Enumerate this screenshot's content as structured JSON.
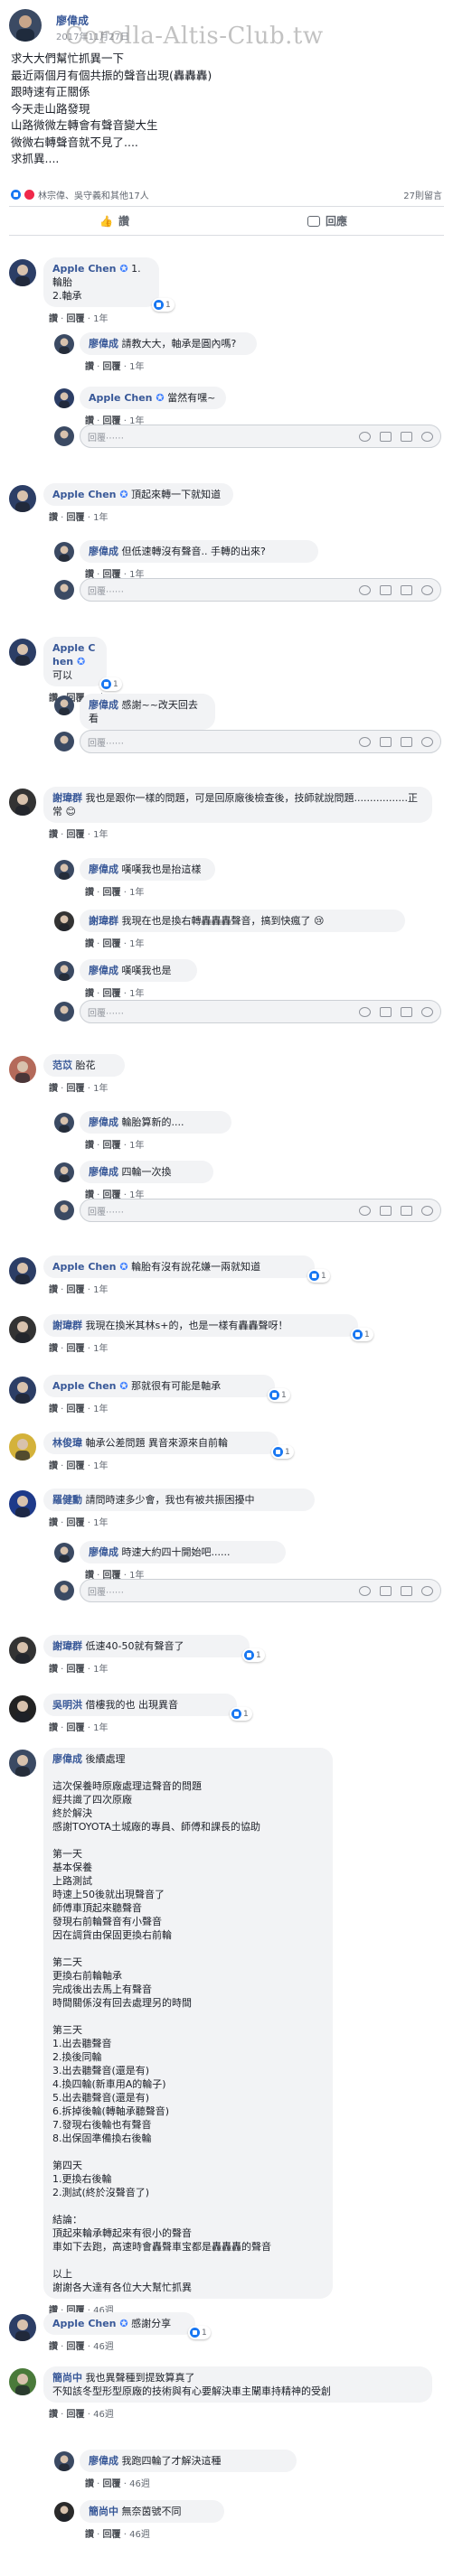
{
  "post": {
    "author": "廖偉成",
    "time": "2017年11月27日",
    "watermark": "Corolla-Altis-Club.tw",
    "body": "求大大們幫忙抓異一下\n最近兩個月有個共振的聲音出現(轟轟轟)\n跟時速有正關係\n今天走山路發現\n山路微微左轉會有聲音變大生\n微微右轉聲音就不見了....\n求抓異....",
    "reactors": "林宗偉、吳守義和其他17人",
    "comment_count": "27則留言",
    "like_label": "讚",
    "comment_label": "回應"
  },
  "labels": {
    "like": "讚",
    "reply": "回覆",
    "placeholder": "回覆⋯⋯"
  },
  "comments": [
    {
      "name": "Apple Chen",
      "badge": "✪",
      "text": "1.輪胎\n2.軸承",
      "count": "1",
      "time": "1年"
    },
    {
      "name": "廖偉成",
      "text": "請教大大，軸承是圓內嗎?",
      "time": "1年"
    },
    {
      "name": "Apple Chen",
      "badge": "✪",
      "text": "當然有嘿~",
      "time": "1年"
    },
    {
      "name": "Apple Chen",
      "badge": "✪",
      "text": "頂起來轉一下就知道",
      "time": "1年"
    },
    {
      "name": "廖偉成",
      "text": "但低速轉沒有聲音.. 手轉的出來?",
      "time": "1年"
    },
    {
      "name": "Apple Chen",
      "badge": "✪",
      "text": "可以",
      "count": "1",
      "time": "1年"
    },
    {
      "name": "廖偉成",
      "text": "感謝~~改天回去看",
      "time": "1年"
    },
    {
      "name": "謝瑋群",
      "text": "我也是跟你一樣的問題，可是回原廠後檢查後，技師就說問題.................正常 😊",
      "time": "1年"
    },
    {
      "name": "廖偉成",
      "text": "嘆嘆我也是抬這樣",
      "time": "1年"
    },
    {
      "name": "謝瑋群",
      "text": "我現在也是換右轉轟轟轟聲音，搞到快瘋了 😢",
      "time": "1年"
    },
    {
      "name": "廖偉成",
      "text": "嘆嘆我也是",
      "time": "1年"
    },
    {
      "name": "范苡",
      "text": "胎花",
      "time": "1年"
    },
    {
      "name": "廖偉成",
      "text": "輪胎算新的....",
      "time": "1年"
    },
    {
      "name": "廖偉成",
      "text": "四輪一次換",
      "time": "1年"
    },
    {
      "name": "Apple Chen",
      "badge": "✪",
      "text": "輪胎有沒有說花嫌一兩就知道",
      "count": "1",
      "time": "1年"
    },
    {
      "name": "謝瑋群",
      "text": "我現在換米其林s+的，也是一樣有轟轟聲呀！",
      "count": "1",
      "time": "1年"
    },
    {
      "name": "Apple Chen",
      "badge": "✪",
      "text": "那就很有可能是軸承",
      "count": "1",
      "time": "1年"
    },
    {
      "name": "林俊瑋",
      "text": "軸承公差問題 異音來源來自前輪",
      "count": "1",
      "time": "1年"
    },
    {
      "name": "羅健勳",
      "text": "請問時速多少會，我也有被共振困擾中",
      "time": "1年"
    },
    {
      "name": "廖偉成",
      "text": "時速大約四十開始吧......",
      "time": "1年"
    },
    {
      "name": "謝瑋群",
      "text": "低速40-50就有聲音了",
      "count": "1",
      "time": "1年"
    },
    {
      "name": "吳明洪",
      "text": "借樓我的也 出現異音",
      "count": "1",
      "time": "1年"
    },
    {
      "name": "廖偉成",
      "text": "後續處理\n\n這次保養時原廠處理這聲音的問題\n經共識了四次原廠\n終於解決\n感謝TOYOTA土城廠的專員、師傅和課長的協助\n\n第一天\n基本保養\n上路測試\n時速上50後就出現聲音了\n師傅車頂起來聽聲音\n發現右前輪聲音有小聲音\n因在調貨由保固更換右前輪\n\n第二天\n更換右前輪軸承\n完成後出去馬上有聲音\n時間關係沒有回去處理另的時間\n\n第三天\n1.出去聽聲音\n2.換後同輪\n3.出去聽聲音(還是有)\n4.換四輪(新車用A的輪子)\n5.出去聽聲音(還是有)\n6.拆掉後輪(轉軸承聽聲音)\n7.發現右後輪也有聲音\n8.出保固準備換右後輪\n\n第四天\n1.更換右後輪\n2.測試(終於沒聲音了)\n\n結論：\n頂起來輪承轉起來有很小的聲音\n車如下去跑，高速時會轟聲車宝都是轟轟轟的聲音\n\n以上\n謝謝各大達有各位大大幫忙抓異",
      "time": "46週"
    },
    {
      "name": "Apple Chen",
      "badge": "✪",
      "text": "感謝分享",
      "count": "1",
      "time": "46週"
    },
    {
      "name": "簡尚中",
      "text": "我也異聲種到提致算真了\n不知該冬型形型原廠的技術與有心要解決車主闡車持精神的受創",
      "time": "46週"
    },
    {
      "name": "廖偉成",
      "text": "我跑四輪了才解決這種",
      "time": "46週"
    },
    {
      "name": "簡尚中",
      "text": "無奈茵號不同",
      "time": "46週"
    }
  ]
}
